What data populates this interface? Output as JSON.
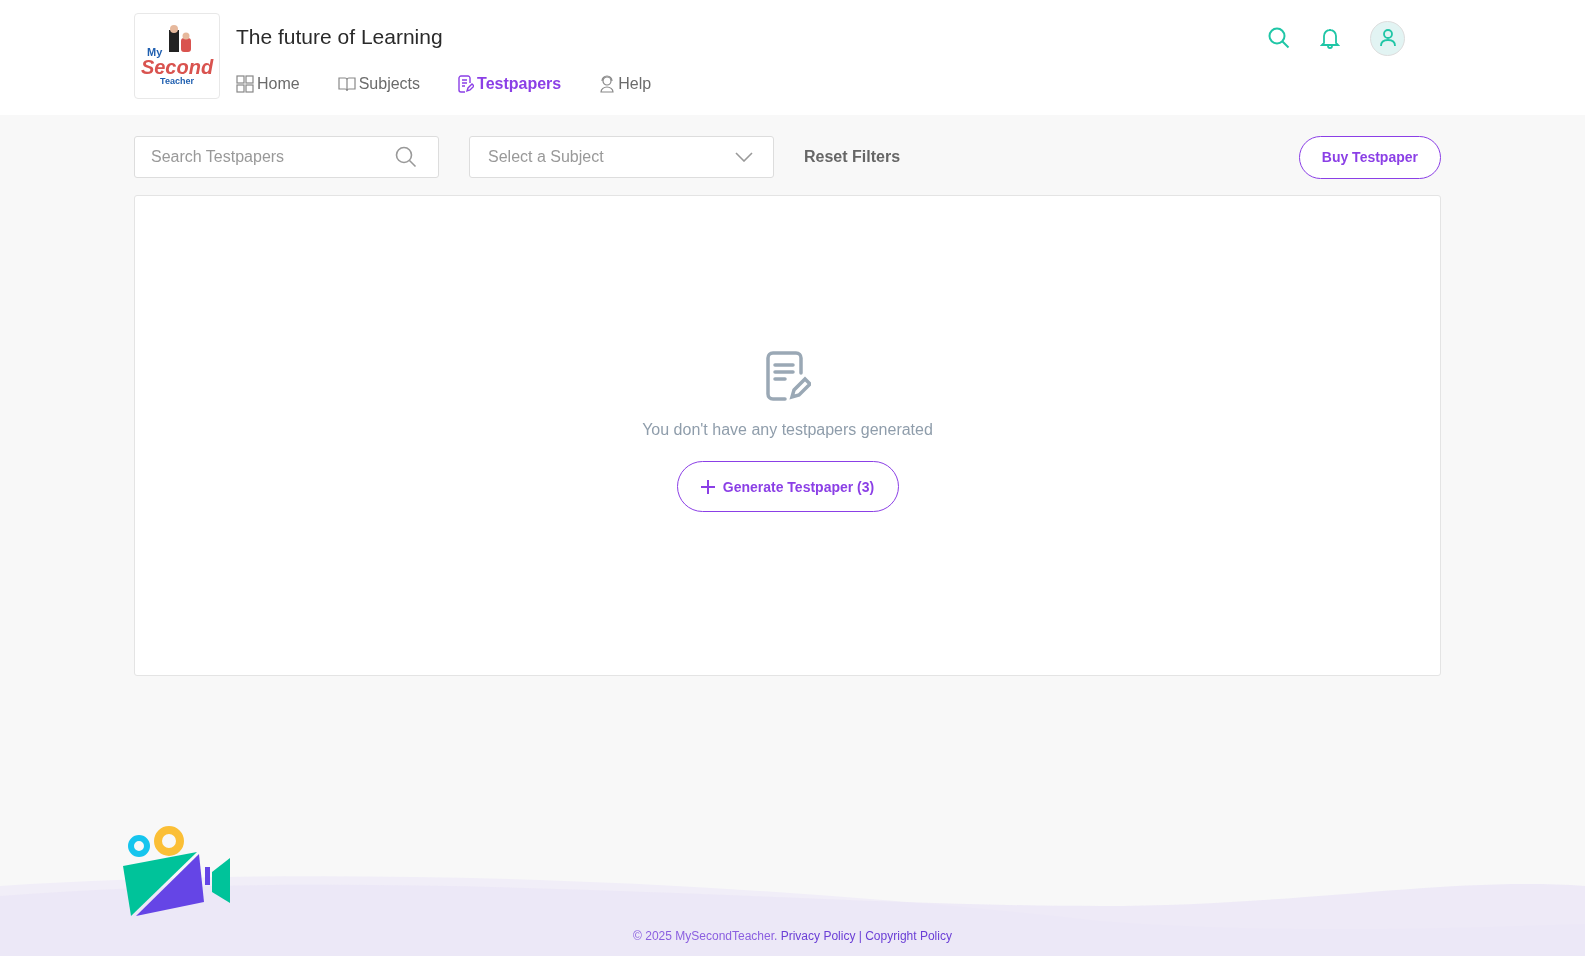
{
  "header": {
    "logo": {
      "line_1": "My",
      "line_2": "Second",
      "line_3": "Teacher"
    },
    "tagline": "The future of Learning",
    "nav": [
      {
        "label": "Home",
        "kind": "grid",
        "selected": false
      },
      {
        "label": "Subjects",
        "kind": "book",
        "selected": false
      },
      {
        "label": "Testpapers",
        "kind": "paper",
        "selected": true
      },
      {
        "label": "Help",
        "kind": "support",
        "selected": false
      }
    ]
  },
  "filters": {
    "search": {
      "placeholder": "Search Testpapers"
    },
    "subject": {
      "placeholder": "Select a Subject"
    },
    "reset": "Reset Filters",
    "buy": "Buy Testpaper"
  },
  "empty_state": {
    "message": "You don't have any testpapers generated",
    "button": "Generate Testpaper (3)"
  },
  "footer": {
    "copyright": "© 2025 MySecondTeacher.",
    "links": [
      {
        "label": "Privacy Policy"
      },
      {
        "label": "Copyright Policy"
      }
    ],
    "separator": "|"
  }
}
